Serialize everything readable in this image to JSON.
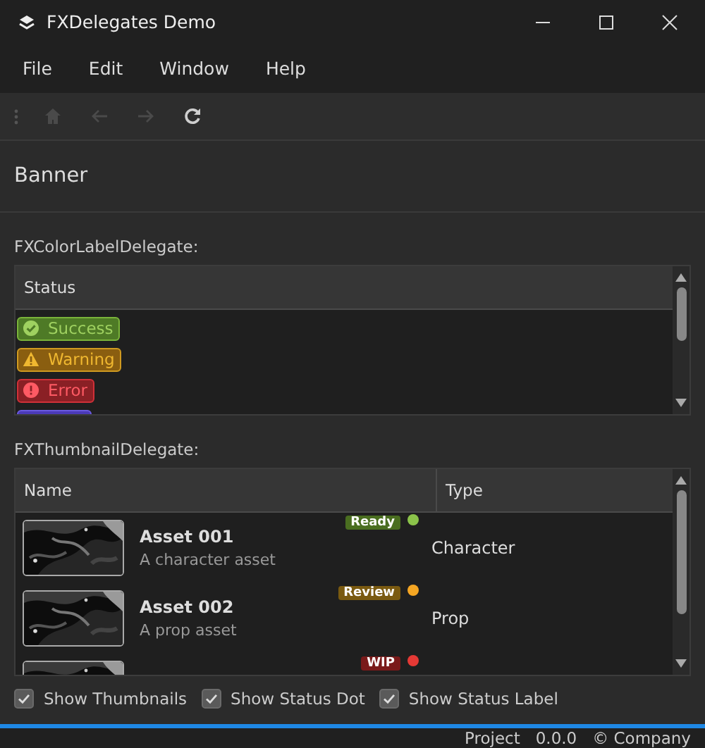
{
  "window": {
    "title": "FXDelegates Demo"
  },
  "menu": [
    "File",
    "Edit",
    "Window",
    "Help"
  ],
  "toolbar": [
    {
      "kind": "home",
      "disabled": true
    },
    {
      "kind": "back",
      "disabled": true
    },
    {
      "kind": "forward",
      "disabled": true
    },
    {
      "kind": "refresh",
      "disabled": false
    }
  ],
  "banner": {
    "text": "Banner"
  },
  "color_label_section": {
    "title": "FXColorLabelDelegate:",
    "columns": [
      "Status"
    ],
    "rows": [
      {
        "kind": "success",
        "label": "Success",
        "color": "#4e7a26"
      },
      {
        "kind": "warning",
        "label": "Warning",
        "color": "#8a5e10"
      },
      {
        "kind": "error",
        "label": "Error",
        "color": "#8a2025"
      },
      {
        "kind": "partial",
        "color": "#4b3ab8"
      }
    ]
  },
  "thumbnail_section": {
    "title": "FXThumbnailDelegate:",
    "columns": [
      "Name",
      "Type"
    ],
    "rows": [
      {
        "name": "Asset 001",
        "description": "A character asset",
        "status_label": {
          "text": "Ready",
          "color": "#4a6e20"
        },
        "status_dot": {
          "color": "#8bc34a"
        },
        "type": "Character"
      },
      {
        "name": "Asset 002",
        "description": "A prop asset",
        "status_label": {
          "text": "Review",
          "color": "#7a5a10"
        },
        "status_dot": {
          "color": "#f5a623"
        },
        "type": "Prop"
      },
      {
        "status_label": {
          "text": "WIP",
          "color": "#7a1a1a"
        },
        "status_dot": {
          "color": "#e53935"
        }
      }
    ]
  },
  "options": [
    {
      "label": "Show Thumbnails",
      "checked": true
    },
    {
      "label": "Show Status Dot",
      "checked": true
    },
    {
      "label": "Show Status Label",
      "checked": true
    }
  ],
  "status_bar": [
    "Project",
    "0.0.0",
    "© Company"
  ]
}
